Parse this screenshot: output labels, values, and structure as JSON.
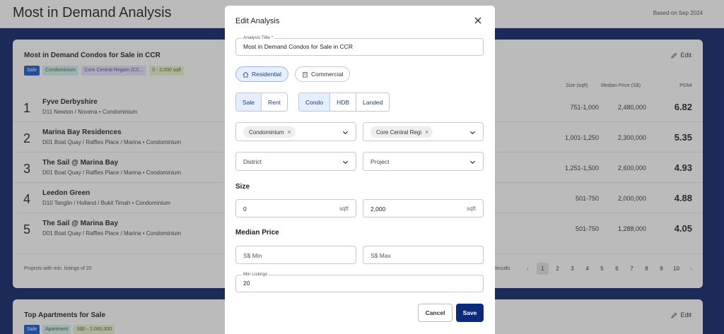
{
  "header": {
    "title": "Most in Demand Analysis",
    "based_on": "Based on Sep 2024"
  },
  "card1": {
    "title": "Most in Demand Condos for Sale in CCR",
    "edit_label": "Edit",
    "tags": [
      "Sale",
      "Condominium",
      "Core Central Region (CC...",
      "0 - 2,000 sqft"
    ],
    "columns": {
      "size": "Size (sqft)",
      "price": "Median Price (S$)",
      "pgmi": "PGMI"
    },
    "rows": [
      {
        "rank": "1",
        "name": "Fyve Derbyshire",
        "sub": "D11 Newton / Novena  • Condominium",
        "size": "751-1,000",
        "price": "2,480,000",
        "pgmi": "6.82"
      },
      {
        "rank": "2",
        "name": "Marina Bay Residences",
        "sub": "D01 Boat Quay / Raffles Place / Marina  • Condominium",
        "size": "1,001-1,250",
        "price": "2,300,000",
        "pgmi": "5.35"
      },
      {
        "rank": "3",
        "name": "The Sail @ Marina Bay",
        "sub": "D01 Boat Quay / Raffles Place / Marina  • Condominium",
        "size": "1,251-1,500",
        "price": "2,600,000",
        "pgmi": "4.93"
      },
      {
        "rank": "4",
        "name": "Leedon Green",
        "sub": "D10 Tanglin / Holland / Bukit Timah  • Condominium",
        "size": "501-750",
        "price": "2,000,000",
        "pgmi": "4.88"
      },
      {
        "rank": "5",
        "name": "The Sail @ Marina Bay",
        "sub": "D01 Boat Quay / Raffles Place / Marina  • Condominium",
        "size": "501-750",
        "price": "1,288,000",
        "pgmi": "4.05"
      }
    ],
    "footnote": "Projects with min. listings of 20",
    "results_label": "Results",
    "pages": [
      "1",
      "2",
      "3",
      "4",
      "5",
      "6",
      "7",
      "8",
      "9",
      "10"
    ],
    "current_page": "1"
  },
  "card2": {
    "title": "Top Apartments for Sale",
    "edit_label": "Edit",
    "tags": [
      "Sale",
      "Apartment",
      "S$0 - 2,000,000"
    ]
  },
  "modal": {
    "title": "Edit Analysis",
    "analysis_title_label": "Analysis Title",
    "required_mark": "*",
    "analysis_title_value": "Most in Demand Condos for Sale in CCR",
    "property_types": [
      "Residential",
      "Commercial"
    ],
    "active_property_type": "Residential",
    "listing_types": [
      "Sale",
      "Rent"
    ],
    "active_listing_type": "Sale",
    "building_types": [
      "Condo",
      "HDB",
      "Landed"
    ],
    "active_building_type": "Condo",
    "category_chip": "Condominium",
    "region_chip": "Core Central Region (CCR)",
    "district_placeholder": "District",
    "project_placeholder": "Project",
    "size_label": "Size",
    "size_min": "0",
    "size_max": "2,000",
    "size_unit": "sqft",
    "median_price_label": "Median Price",
    "price_min_placeholder": "S$ Min",
    "price_max_placeholder": "S$ Max",
    "min_listings_label": "Min Listings",
    "min_listings_value": "20",
    "cancel_label": "Cancel",
    "save_label": "Save"
  }
}
